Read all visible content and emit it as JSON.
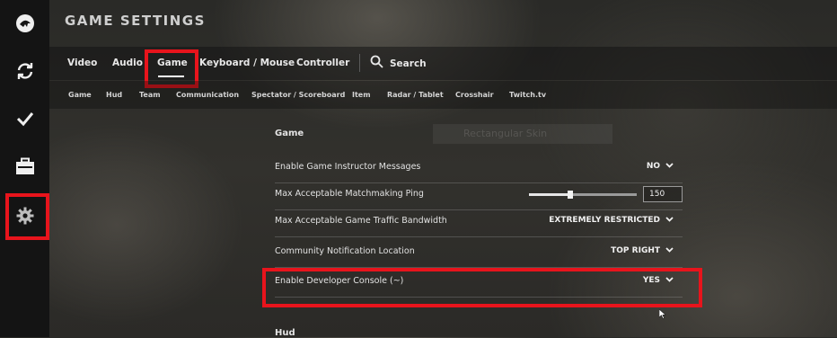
{
  "app": {
    "title": "GAME SETTINGS"
  },
  "sidebar": {
    "items": [
      {
        "icon": "main-menu-logo-icon"
      },
      {
        "icon": "refresh-icon"
      },
      {
        "icon": "checkmark-icon"
      },
      {
        "icon": "briefcase-icon"
      },
      {
        "icon": "gear-icon"
      }
    ]
  },
  "tabs": [
    {
      "label": "Video"
    },
    {
      "label": "Audio"
    },
    {
      "label": "Game"
    },
    {
      "label": "Keyboard / Mouse"
    },
    {
      "label": "Controller"
    }
  ],
  "search": {
    "label": "Search"
  },
  "subtabs": [
    {
      "label": "Game"
    },
    {
      "label": "Hud"
    },
    {
      "label": "Team"
    },
    {
      "label": "Communication"
    },
    {
      "label": "Spectator / Scoreboard"
    },
    {
      "label": "Item"
    },
    {
      "label": "Radar / Tablet"
    },
    {
      "label": "Crosshair"
    },
    {
      "label": "Twitch.tv"
    }
  ],
  "ghost_search": {
    "text": "Rectangular Skin"
  },
  "sections": {
    "game": "Game",
    "hud": "Hud"
  },
  "settings": [
    {
      "label": "Enable Game Instructor Messages",
      "value": "NO"
    },
    {
      "label": "Max Acceptable Matchmaking Ping",
      "value": "150",
      "slider_fraction": 0.38
    },
    {
      "label": "Max Acceptable Game Traffic Bandwidth",
      "value": "EXTREMELY RESTRICTED"
    },
    {
      "label": "Community Notification Location",
      "value": "TOP RIGHT"
    },
    {
      "label": "Enable Developer Console (~)",
      "value": "YES"
    }
  ],
  "colors": {
    "highlight": "#e8141c",
    "sidebar_bg": "#141414"
  }
}
